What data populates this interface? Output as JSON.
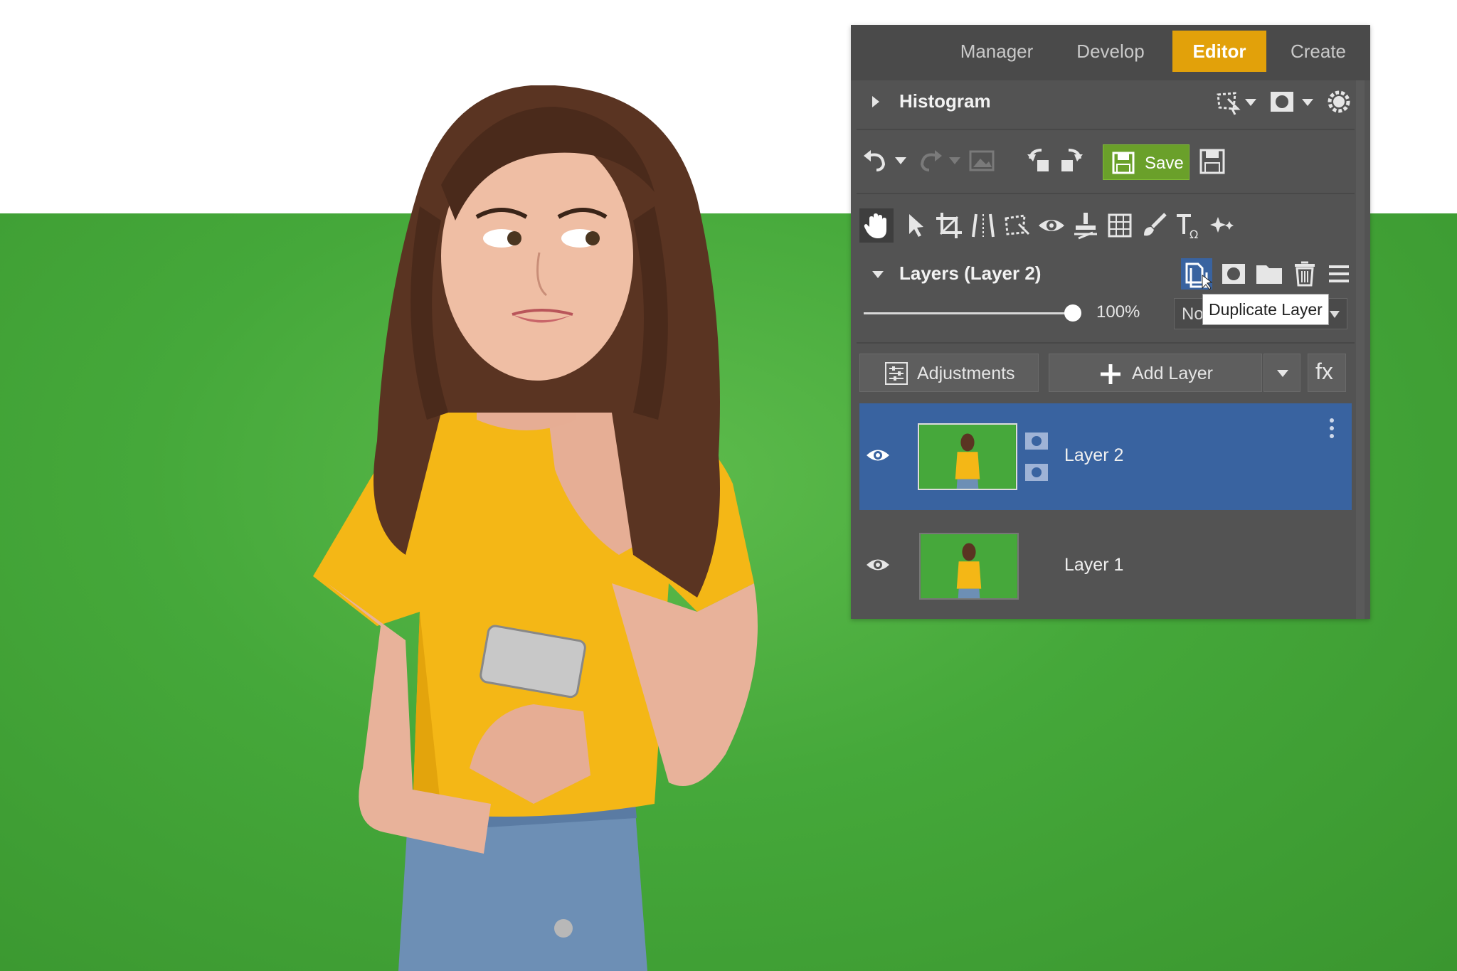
{
  "tabs": [
    {
      "label": "Manager",
      "active": false
    },
    {
      "label": "Develop",
      "active": false
    },
    {
      "label": "Editor",
      "active": true
    },
    {
      "label": "Create",
      "active": false
    }
  ],
  "histogram": {
    "title": "Histogram"
  },
  "toolbar": {
    "save_label": "Save"
  },
  "layers": {
    "title": "Layers (Layer 2)",
    "opacity": "100%",
    "blend_mode": "No",
    "tooltip": "Duplicate Layer",
    "adjustments_label": "Adjustments",
    "add_layer_label": "Add Layer",
    "fx_label": "fx",
    "items": [
      {
        "name": "Layer 2",
        "selected": true,
        "visible": true
      },
      {
        "name": "Layer 1",
        "selected": false,
        "visible": true
      }
    ]
  },
  "colors": {
    "accent": "#e2a10a",
    "panel": "#535353",
    "selected_layer": "#3963a0",
    "save_green": "#6aa02a",
    "background_green": "#45a83a"
  }
}
